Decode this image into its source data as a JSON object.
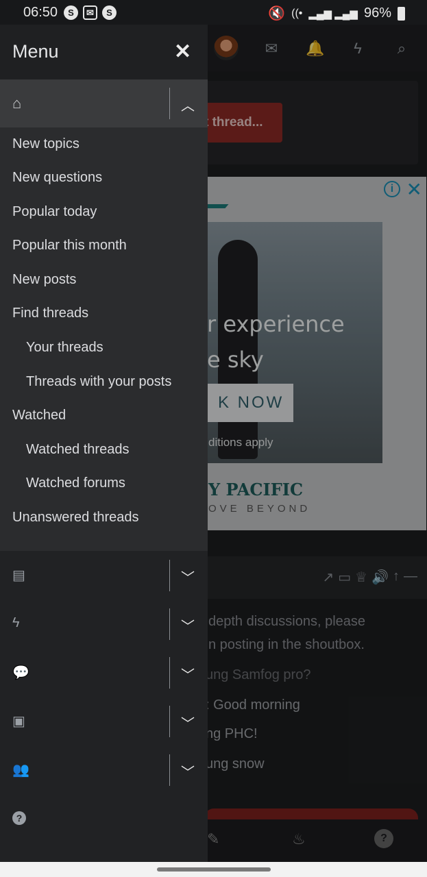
{
  "status_bar": {
    "time": "06:50",
    "battery": "96%",
    "left_icons": [
      "S",
      "✉",
      "S"
    ]
  },
  "background": {
    "new_thread_text": "t thread...",
    "ad": {
      "headline_1": "r experience",
      "headline_2": "e sky",
      "cta": "K NOW",
      "conditions": "ditions apply",
      "brand": "Y PACIFIC",
      "tagline": "OVE BEYOND",
      "info": "i",
      "close": "✕"
    },
    "shoutbox": {
      "notice_1": "depth discussions, please",
      "notice_2": "n posting in the shoutbox.",
      "messages": [
        "ung Samfog pro?",
        ": Good morning",
        "ng PHC!",
        "ung snow"
      ]
    }
  },
  "menu": {
    "title": "Menu",
    "close": "✕",
    "home_items": [
      {
        "label": "New topics",
        "indent": false
      },
      {
        "label": "New questions",
        "indent": false
      },
      {
        "label": "Popular today",
        "indent": false
      },
      {
        "label": "Popular this month",
        "indent": false
      },
      {
        "label": "New posts",
        "indent": false
      },
      {
        "label": "Find threads",
        "indent": false
      },
      {
        "label": "Your threads",
        "indent": true
      },
      {
        "label": "Threads with your posts",
        "indent": true
      },
      {
        "label": "Watched",
        "indent": false
      },
      {
        "label": "Watched threads",
        "indent": true
      },
      {
        "label": "Watched forums",
        "indent": true
      },
      {
        "label": "Unanswered threads",
        "indent": false
      }
    ],
    "sections": [
      {
        "icon": "forums-icon"
      },
      {
        "icon": "whats-new-icon"
      },
      {
        "icon": "chat-icon"
      },
      {
        "icon": "media-icon"
      },
      {
        "icon": "members-icon"
      }
    ],
    "help_icon": "help-icon"
  },
  "colors": {
    "menu_bg": "#212224",
    "submenu_bg": "#2b2c2e",
    "active_row": "#3a3b3d",
    "accent_red": "#8c2a26"
  }
}
